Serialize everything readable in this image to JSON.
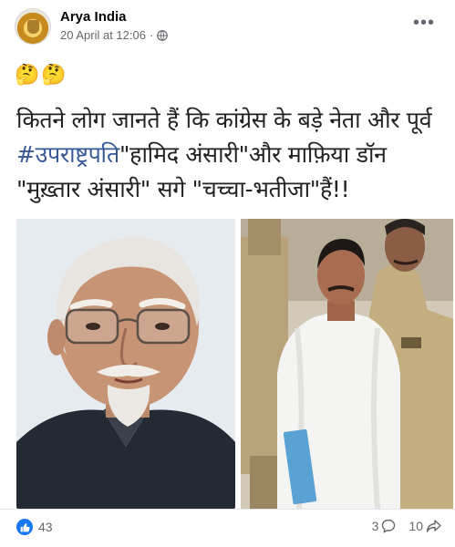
{
  "post": {
    "page_name": "Arya India",
    "timestamp": "20 April at 12:06",
    "privacy_icon": "globe-icon",
    "emojis": "🤔🤔",
    "image_text": {
      "line1": "कितने लोग जानते हैं कि कांग्रेस के बड़े नेता और पूर्व",
      "hashtag": "#उपराष्ट्रपति",
      "line2_rest": "\"हामिद अंसारी\"और माफ़िया डॉन",
      "line3": "\"मुख़्तार अंसारी\" सगे \"चच्चा-भतीजा\"हैं!!"
    }
  },
  "engagement": {
    "reactions_count": "43",
    "comments_count": "3",
    "shares_count": "10"
  },
  "colors": {
    "brand_blue": "#1877f2",
    "hashtag": "#385898",
    "meta_grey": "#65676b"
  }
}
